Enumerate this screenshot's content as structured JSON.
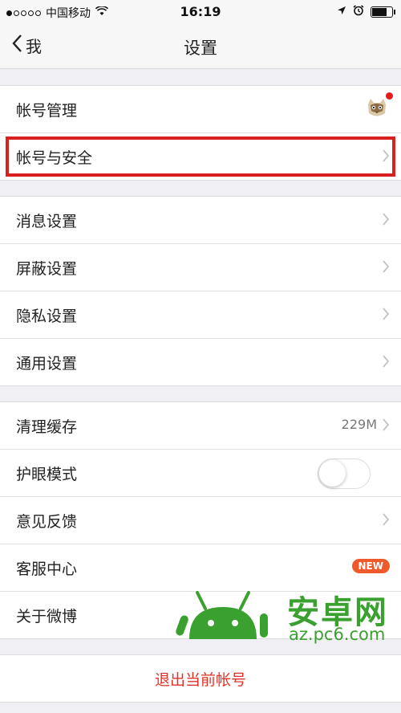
{
  "status_bar": {
    "carrier": "中国移动",
    "time": "16:19",
    "signal_icon": "signal-dots-icon",
    "wifi_icon": "wifi-icon",
    "location_icon": "location-arrow-icon",
    "alarm_icon": "alarm-icon",
    "battery_level": 0.8
  },
  "nav": {
    "back_label": "我",
    "title": "设置"
  },
  "section1": {
    "account_manage": "帐号管理",
    "account_security": "帐号与安全"
  },
  "section2": {
    "items": [
      "消息设置",
      "屏蔽设置",
      "隐私设置",
      "通用设置"
    ]
  },
  "section3": {
    "clear_cache": "清理缓存",
    "cache_size": "229M",
    "eye_mode": "护眼模式",
    "eye_mode_on": false,
    "feedback": "意见反馈",
    "customer_service": "客服中心",
    "new_badge": "NEW",
    "about": "关于微博"
  },
  "logout": {
    "label": "退出当前帐号"
  },
  "watermark": {
    "brand": "安卓网",
    "url": "az.pc6.com"
  },
  "colors": {
    "accent_red": "#d7201f",
    "logout_red": "#e0342a",
    "badge_orange": "#ef5a2d",
    "watermark_green": "#3aa02f"
  }
}
